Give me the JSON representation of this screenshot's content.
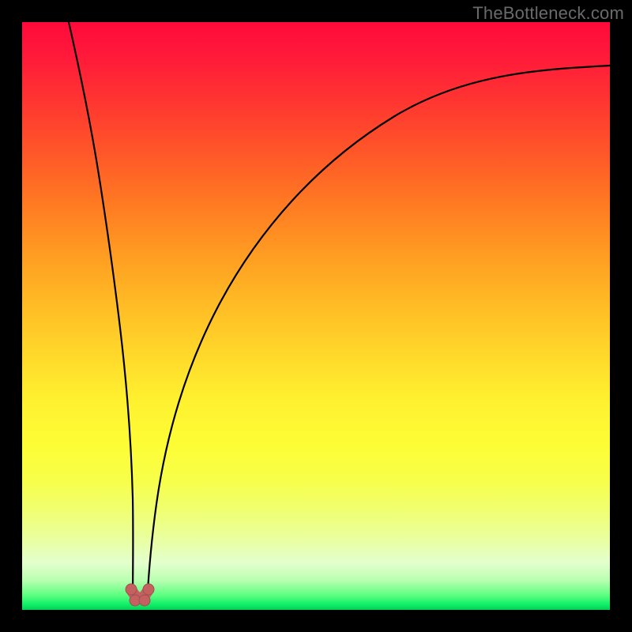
{
  "watermark": "TheBottleneck.com",
  "chart_data": {
    "type": "line",
    "title": "",
    "xlabel": "",
    "ylabel": "",
    "xlim": [
      0,
      100
    ],
    "ylim": [
      0,
      100
    ],
    "grid": false,
    "legend": false,
    "series": [
      {
        "name": "left-curve",
        "x": [
          8,
          10,
          11,
          12,
          13,
          14,
          15,
          16,
          17,
          18,
          18.8
        ],
        "y": [
          100,
          91,
          83,
          74,
          64,
          53,
          41,
          29,
          17,
          7,
          1
        ]
      },
      {
        "name": "right-curve",
        "x": [
          21.2,
          22,
          25,
          30,
          36,
          43,
          52,
          62,
          74,
          87,
          100
        ],
        "y": [
          1,
          6,
          25,
          46,
          60,
          70,
          78,
          83,
          87,
          90,
          92.5
        ]
      },
      {
        "name": "valley-thick",
        "x": [
          18.8,
          19.2,
          19.6,
          20.0,
          20.4,
          20.8,
          21.2
        ],
        "y": [
          1,
          0.3,
          0.05,
          0,
          0.05,
          0.3,
          1
        ]
      }
    ],
    "valley_marker_x": 20,
    "notes": "Green band at y≈0–3 spans full width; color gradient encodes y from red (high) to green (low)."
  }
}
